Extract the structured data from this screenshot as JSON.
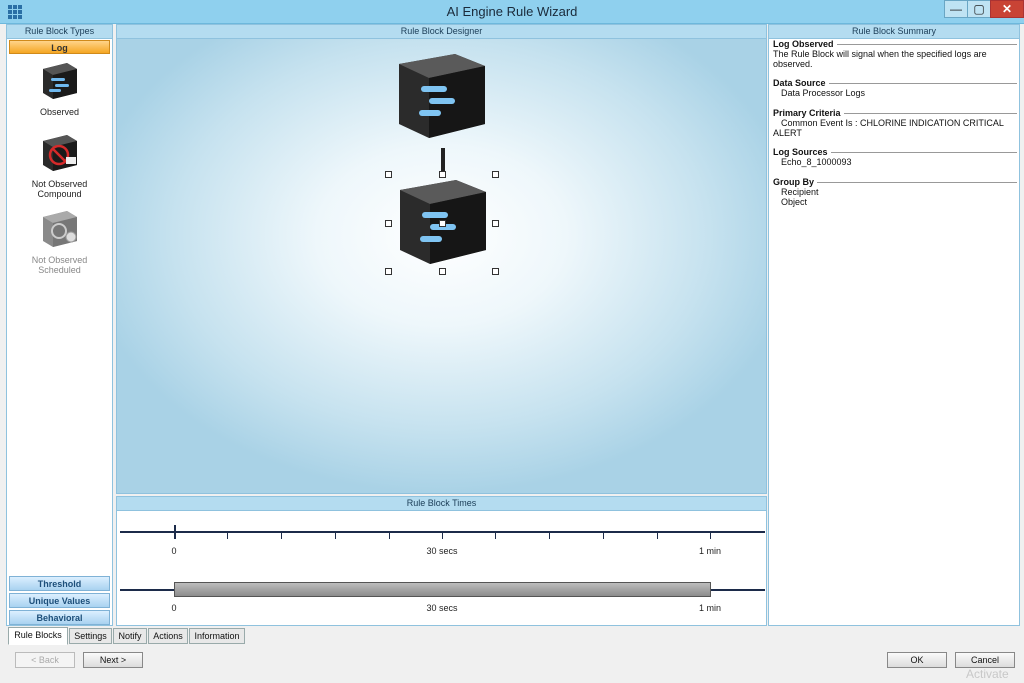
{
  "window": {
    "title": "AI Engine Rule Wizard",
    "min": "—",
    "max": "▢",
    "close": "✕"
  },
  "left_panel": {
    "header": "Rule Block Types",
    "active_category": "Log",
    "block_types": [
      {
        "label": "Observed",
        "icon": "observed-cube-icon"
      },
      {
        "label_line1": "Not Observed",
        "label_line2": "Compound",
        "icon": "not-observed-compound-icon"
      },
      {
        "label_line1": "Not Observed",
        "label_line2": "Scheduled",
        "icon": "not-observed-scheduled-icon",
        "disabled": true
      }
    ],
    "categories": [
      "Threshold",
      "Unique Values",
      "Behavioral"
    ]
  },
  "designer": {
    "header": "Rule Block Designer"
  },
  "times": {
    "header": "Rule Block Times",
    "labels": [
      "0",
      "30 secs",
      "1 min"
    ]
  },
  "summary": {
    "header": "Rule Block Summary",
    "sections": [
      {
        "title": "Log Observed",
        "body": "The Rule Block will signal when the specified logs are observed."
      },
      {
        "title": "Data Source",
        "body": "Data Processor Logs"
      },
      {
        "title": "Primary Criteria",
        "body_line1": "Common Event Is :  CHLORINE INDICATION CRITICAL",
        "body_line2": "ALERT"
      },
      {
        "title": "Log Sources",
        "body": "Echo_8_1000093"
      },
      {
        "title": "Group By",
        "body_line1": "Recipient",
        "body_line2": "Object"
      }
    ]
  },
  "tabs": [
    "Rule Blocks",
    "Settings",
    "Notify",
    "Actions",
    "Information"
  ],
  "buttons": {
    "back": "< Back",
    "next": "Next >",
    "ok": "OK",
    "cancel": "Cancel"
  },
  "watermark": "Activate"
}
